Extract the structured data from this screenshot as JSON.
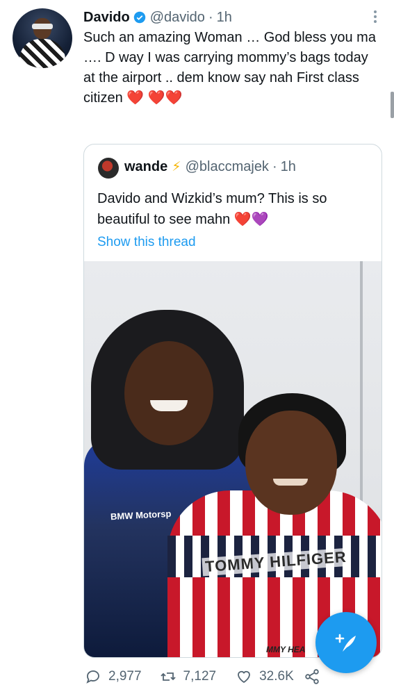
{
  "tweet": {
    "author_name": "Davido",
    "author_handle": "@davido",
    "separator": "·",
    "time": "1h",
    "text": "Such an amazing Woman … God bless you ma …. D way I was carrying mommy’s bags today at the airport .. dem know say nah First class citizen ❤️ ❤️❤️"
  },
  "quoted": {
    "author_name": "wande",
    "author_emoji": "⚡",
    "author_handle": "@blaccmajek",
    "separator": "·",
    "time": "1h",
    "text": "Davido and Wizkid’s mum? This is so beautiful to see mahn ❤️💜",
    "show_thread": "Show this thread",
    "photo": {
      "jacket_print": "BMW Motorsp",
      "sweater_print": "TOMMY HILFIGER",
      "watermark": "MMY HEA"
    }
  },
  "actions": {
    "replies": "2,977",
    "retweets": "7,127",
    "likes": "32.6K"
  },
  "colors": {
    "accent": "#1d9bf0",
    "secondary_text": "#536471"
  },
  "icons": [
    "verified-badge-icon",
    "more-options-icon",
    "reply-icon",
    "retweet-icon",
    "like-icon",
    "share-icon",
    "compose-icon"
  ]
}
